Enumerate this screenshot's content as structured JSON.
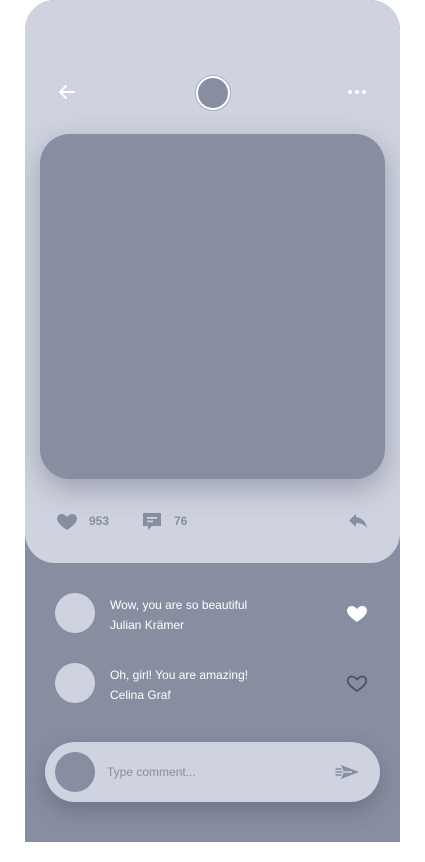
{
  "post": {
    "likes": "953",
    "comments_count": "76"
  },
  "comments": [
    {
      "text": "Wow, you are so beautiful",
      "author": "Julian Krämer",
      "liked": true
    },
    {
      "text": "Oh, girl! You are amazing!",
      "author": "Celina Graf",
      "liked": false
    }
  ],
  "composer": {
    "placeholder": "Type comment..."
  },
  "icons": {
    "back": "arrow-left-icon",
    "more": "more-horizontal-icon",
    "like": "heart-icon",
    "comment": "comment-icon",
    "share": "reply-icon",
    "send": "send-icon"
  },
  "colors": {
    "card": "#cfd3df",
    "accent": "#878ea1",
    "white": "#ffffff"
  }
}
